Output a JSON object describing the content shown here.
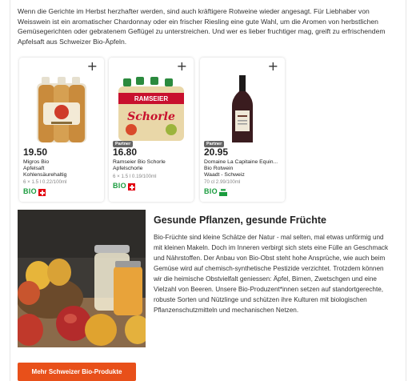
{
  "intro": "Wenn die Gerichte im Herbst herzhafter werden, sind auch kräftigere Rotweine wieder angesagt. Für Liebhaber von Weisswein ist ein aromatischer Chardonnay oder ein frischer Riesling eine gute Wahl, um die Aromen von herbstlichen Gemüsegerichten oder gebratenem Geflügel zu unterstreichen. Und wer es lieber fruchtiger mag, greift zu erfrischendem Apfelsaft aus Schweizer Bio-Äpfeln.",
  "products": [
    {
      "add_icon": "+",
      "partner": "",
      "price": "19.50",
      "name_lines": [
        "Migros Bio",
        "Apfelsaft",
        "Kohlensäurehaltig"
      ],
      "unit": "6 × 1.5 l  0.22/100ml",
      "bio": "BIO",
      "origin_icon": "swiss-cross-icon"
    },
    {
      "add_icon": "+",
      "partner": "Partner",
      "price": "16.80",
      "name_lines": [
        "Ramseier Bio Schorle",
        "Apfelschorle"
      ],
      "unit": "6 × 1.5 l  0.19/100ml",
      "bio": "BIO",
      "origin_icon": "swiss-cross-icon"
    },
    {
      "add_icon": "+",
      "partner": "Partner",
      "price": "20.95",
      "name_lines": [
        "Domaine La Capitaine Equin...",
        "Bio Rotwein",
        "Waadt - Schweiz"
      ],
      "unit": "70 cl  2.99/100ml",
      "bio": "BIO",
      "origin_icon": "vaud-flag-icon"
    }
  ],
  "article": {
    "title": "Gesunde Pflanzen, gesunde Früchte",
    "body": "Bio-Früchte sind kleine Schätze der Natur - mal selten, mal etwas unförmig und mit kleinen Makeln. Doch im Inneren verbirgt sich stets eine Fülle an Geschmack und Nährstoffen. Der Anbau von Bio-Obst steht hohe Ansprüche, wie auch beim Gemüse wird auf chemisch-synthetische Pestizide verzichtet. Trotzdem können wir die heimische Obstvielfalt geniessen: Äpfel, Birnen, Zwetschgen und eine Vielzahl von Beeren. Unsere Bio-Produzent*innen setzen auf standortgerechte, robuste Sorten und Nützlinge und schützen ihre Kulturen mit biologischen Pflanzenschutzmitteln und mechanischen Netzen."
  },
  "cta": "Mehr Schweizer Bio-Produkte",
  "colors": {
    "accent": "#e8501a",
    "bio_green": "#1a9c3e",
    "swiss_red": "#e3000f"
  }
}
